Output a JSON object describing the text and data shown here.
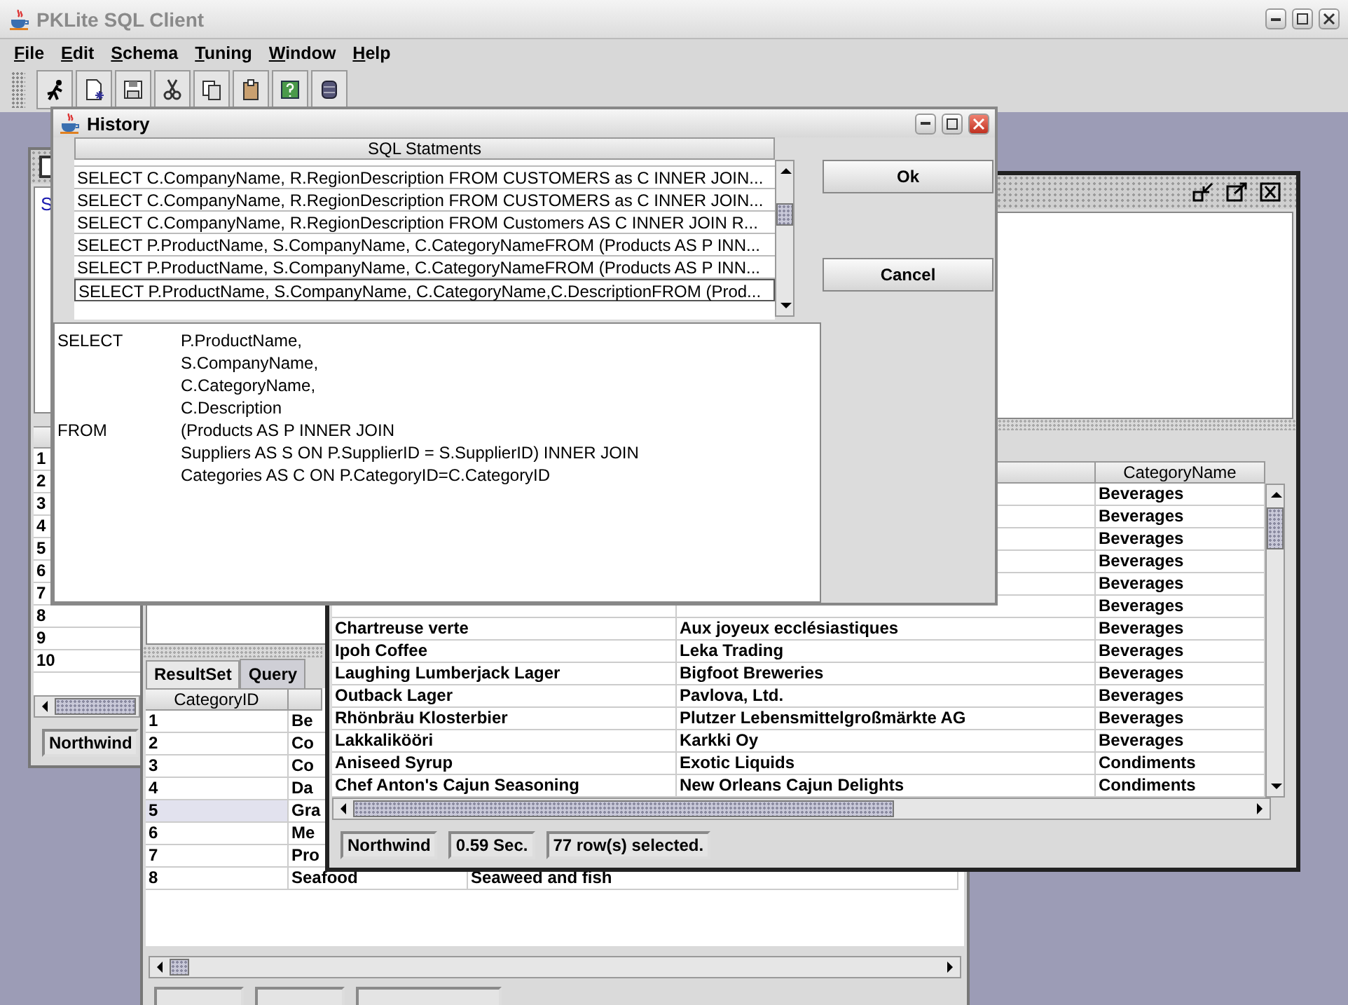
{
  "window": {
    "title": "PKLite SQL Client"
  },
  "menu": [
    "File",
    "Edit",
    "Schema",
    "Tuning",
    "Window",
    "Help"
  ],
  "back_window": {
    "editor_text": "S",
    "row_numbers": [
      "1",
      "2",
      "3",
      "4",
      "5",
      "6",
      "7",
      "8",
      "9",
      "10"
    ],
    "status": "Northwind"
  },
  "category_window": {
    "tabs": [
      {
        "label": "ResultSet",
        "selected": true
      },
      {
        "label": "Query",
        "selected": false
      }
    ],
    "columns": [
      "CategoryID"
    ],
    "rows": [
      {
        "cells": [
          "1",
          "Be"
        ],
        "selected": false
      },
      {
        "cells": [
          "2",
          "Co"
        ],
        "selected": false
      },
      {
        "cells": [
          "3",
          "Co"
        ],
        "selected": false
      },
      {
        "cells": [
          "4",
          "Da"
        ],
        "selected": false
      },
      {
        "cells": [
          "5",
          "Gra"
        ],
        "selected": true
      },
      {
        "cells": [
          "6",
          "Me"
        ],
        "selected": false
      },
      {
        "cells": [
          "7",
          "Pro"
        ],
        "selected": false
      },
      {
        "cells": [
          "8",
          "Seafood",
          "Seaweed and fish"
        ],
        "selected": false
      }
    ]
  },
  "products_window": {
    "columns": [
      "CategoryName"
    ],
    "rows": [
      {
        "category": "Beverages"
      },
      {
        "category": "Beverages"
      },
      {
        "category": "Beverages"
      },
      {
        "category": "Beverages"
      },
      {
        "category": "Beverages"
      },
      {
        "category": "Beverages"
      },
      {
        "product": "Chartreuse verte",
        "supplier": "Aux joyeux ecclésiastiques",
        "category": "Beverages"
      },
      {
        "product": "Ipoh Coffee",
        "supplier": "Leka Trading",
        "category": "Beverages"
      },
      {
        "product": "Laughing Lumberjack Lager",
        "supplier": "Bigfoot Breweries",
        "category": "Beverages"
      },
      {
        "product": "Outback Lager",
        "supplier": "Pavlova, Ltd.",
        "category": "Beverages"
      },
      {
        "product": "Rhönbräu Klosterbier",
        "supplier": "Plutzer Lebensmittelgroßmärkte AG",
        "category": "Beverages"
      },
      {
        "product": "Lakkalikööri",
        "supplier": "Karkki Oy",
        "category": "Beverages"
      },
      {
        "product": "Aniseed Syrup",
        "supplier": "Exotic Liquids",
        "category": "Condiments"
      },
      {
        "product": "Chef Anton's Cajun Seasoning",
        "supplier": "New Orleans Cajun Delights",
        "category": "Condiments"
      }
    ],
    "status": [
      "Northwind",
      "0.59 Sec.",
      "77 row(s) selected."
    ]
  },
  "history": {
    "title": "History",
    "column": "SQL Statments",
    "statements": [
      {
        "text": "SELECT C.CompanyName, R.RegionDescription FROM CUSTOMERS as C INNER JOIN...",
        "selected": false
      },
      {
        "text": "SELECT C.CompanyName, R.RegionDescription FROM CUSTOMERS as C INNER JOIN...",
        "selected": false
      },
      {
        "text": "SELECT C.CompanyName, R.RegionDescription FROM Customers AS C INNER JOIN R...",
        "selected": false
      },
      {
        "text": "SELECT P.ProductName, S.CompanyName, C.CategoryNameFROM (Products AS P INN...",
        "selected": false
      },
      {
        "text": "SELECT P.ProductName, S.CompanyName, C.CategoryNameFROM (Products AS P INN...",
        "selected": false
      },
      {
        "text": "SELECT P.ProductName, S.CompanyName, C.CategoryName,C.DescriptionFROM (Prod...",
        "selected": true
      }
    ],
    "sql_lines": [
      {
        "keyword": "SELECT",
        "text": "P.ProductName,"
      },
      {
        "text": "S.CompanyName,"
      },
      {
        "text": "C.CategoryName,"
      },
      {
        "text": "C.Description"
      },
      {
        "keyword": "FROM",
        "text": "(Products AS P INNER JOIN"
      },
      {
        "text": "Suppliers AS S ON P.SupplierID = S.SupplierID) INNER JOIN"
      },
      {
        "text": "Categories AS C ON P.CategoryID=C.CategoryID"
      }
    ],
    "buttons": [
      "Ok",
      "Cancel"
    ]
  }
}
